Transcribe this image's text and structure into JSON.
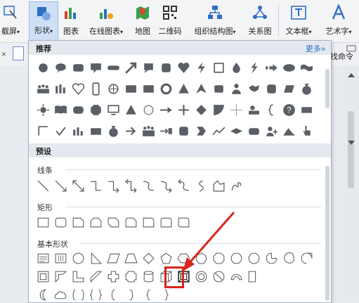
{
  "ribbon": {
    "buttons": [
      {
        "name": "screenshot-button",
        "label": "截屏",
        "caret": "▾"
      },
      {
        "name": "shape-button",
        "label": "形状",
        "caret": "▾",
        "active": true
      },
      {
        "name": "chart-button",
        "label": "图表",
        "caret": ""
      },
      {
        "name": "online-chart-button",
        "label": "在线图表",
        "caret": "▾"
      },
      {
        "name": "map-button",
        "label": "地图",
        "caret": ""
      },
      {
        "name": "qrcode-button",
        "label": "二维码",
        "caret": ""
      },
      {
        "name": "org-chart-button",
        "label": "组织结构图",
        "caret": "▾"
      },
      {
        "name": "relation-button",
        "label": "关系图",
        "caret": ""
      },
      {
        "name": "textbox-button",
        "label": "文本框",
        "caret": "▾"
      },
      {
        "name": "wordart-button",
        "label": "艺术字",
        "caret": "▾"
      }
    ]
  },
  "toolbar": {
    "close_glyph": "×",
    "command_text": "找命令"
  },
  "panel": {
    "recommended": {
      "title": "推荐",
      "more": "更多»"
    },
    "preset": {
      "title": "预设"
    },
    "lines_title": "线条",
    "rect_title": "矩形",
    "basic_title": "基本形状"
  },
  "colors": {
    "accent": "#2a6ec8",
    "highlight": "#d9241c",
    "icon_gray": "#5a5f66"
  }
}
